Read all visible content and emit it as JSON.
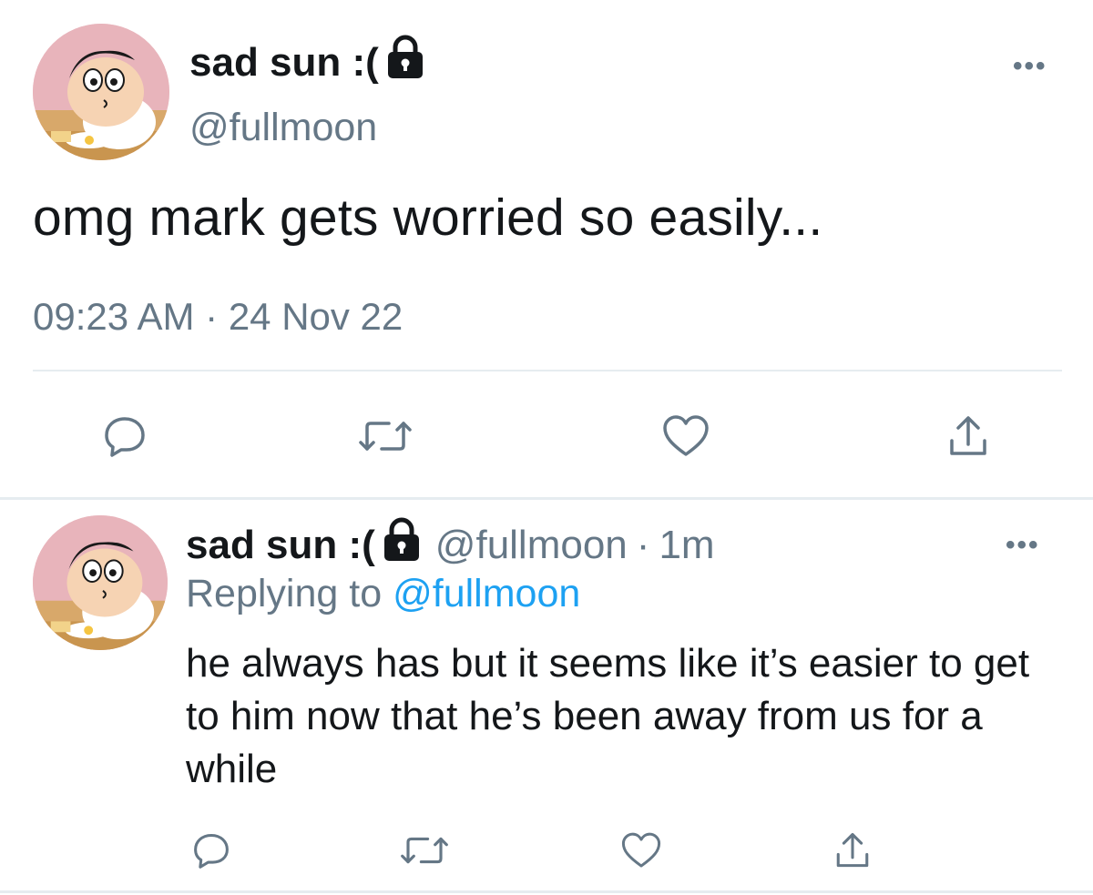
{
  "main_tweet": {
    "display_name": "sad sun :(",
    "handle": "@fullmoon",
    "text": "omg mark gets worried so easily...",
    "time": "09:23 AM",
    "separator": "·",
    "date": "24 Nov 22",
    "more_label": "•••"
  },
  "reply_tweet": {
    "display_name": "sad sun :(",
    "handle": "@fullmoon",
    "separator": "·",
    "age": "1m",
    "replying_prefix": "Replying to",
    "replying_to": "@fullmoon",
    "text": "he always has but it seems like it’s easier to get to him now that he’s been away from us for a while",
    "more_label": "•••"
  },
  "icons": {
    "lock": "lock-icon",
    "reply": "reply-icon",
    "retweet": "retweet-icon",
    "like": "heart-icon",
    "share": "share-icon",
    "more": "more-icon"
  },
  "colors": {
    "text": "#14171a",
    "secondary": "#657786",
    "link": "#1da1f2",
    "divider": "#e6ecf0"
  }
}
